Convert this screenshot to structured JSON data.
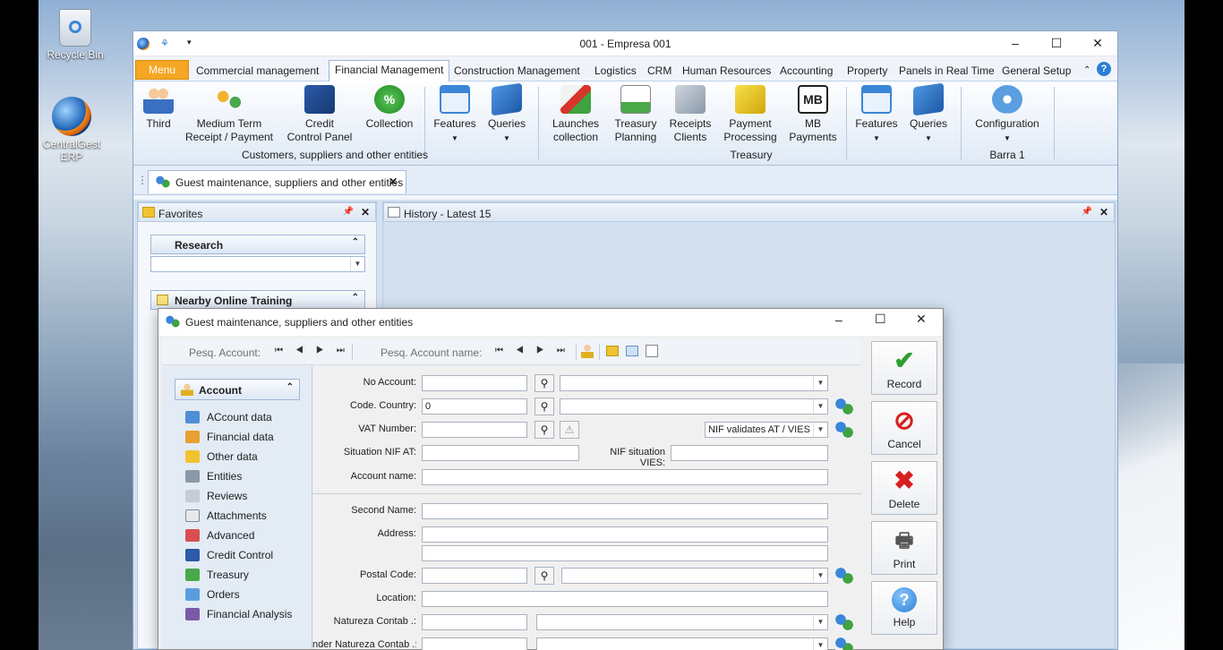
{
  "desktop": {
    "icons": [
      {
        "label": "Recycle Bin"
      },
      {
        "label": "CentralGest ERP"
      }
    ]
  },
  "window": {
    "title": "001 - Empresa 001",
    "controls": {
      "minimize": "–",
      "maximize": "☐",
      "close": "✕"
    }
  },
  "tabs": {
    "menu": "Menu",
    "items": [
      "Commercial management",
      "Financial Management",
      "Construction Management",
      "Logistics",
      "CRM",
      "Human Resources",
      "Accounting",
      "Property",
      "Panels in Real Time",
      "General Setup"
    ],
    "active": "Financial Management"
  },
  "ribbon": {
    "buttons": [
      {
        "label": "Third",
        "icon": "people-icon"
      },
      {
        "label": "Medium Term\nReceipt / Payment",
        "icon": "transfer-icon"
      },
      {
        "label": "Credit\nControl Panel",
        "icon": "card-icon"
      },
      {
        "label": "Collection",
        "icon": "percent-icon"
      },
      {
        "label": "Features",
        "icon": "window-icon"
      },
      {
        "label": "Queries",
        "icon": "book-icon"
      },
      {
        "label": "Launches\ncollection",
        "icon": "launch-icon"
      },
      {
        "label": "Treasury\nPlanning",
        "icon": "chart-icon"
      },
      {
        "label": "Receipts\nClients",
        "icon": "receipt-icon"
      },
      {
        "label": "Payment\nProcessing",
        "icon": "payment-icon"
      },
      {
        "label": "MB\nPayments",
        "icon": "mb-icon"
      },
      {
        "label": "Features",
        "icon": "window-icon"
      },
      {
        "label": "Queries",
        "icon": "book-icon"
      },
      {
        "label": "Configuration",
        "icon": "gear-icon"
      }
    ],
    "groups": [
      "Customers, suppliers and other entities",
      "Treasury",
      "Barra 1"
    ]
  },
  "doc_tab": {
    "label": "Guest maintenance, suppliers and other entities"
  },
  "favorites": {
    "title": "Favorites",
    "research": "Research",
    "training": "Nearby Online Training"
  },
  "history": {
    "title": "History - Latest 15"
  },
  "dialog": {
    "title": "Guest maintenance, suppliers and other entities",
    "toolbar": {
      "pesq_account": "Pesq. Account:",
      "pesq_account_name": "Pesq. Account name:"
    },
    "nav": {
      "header": "Account",
      "items": [
        "ACcount data",
        "Financial data",
        "Other data",
        "Entities",
        "Reviews",
        "Attachments",
        "Advanced",
        "Credit Control",
        "Treasury",
        "Orders",
        "Financial Analysis"
      ]
    },
    "form": {
      "no_account": "No Account:",
      "code_country": "Code. Country:",
      "code_country_value": "0",
      "vat_number": "VAT Number:",
      "nif_validates": "NIF validates AT / VIES",
      "situation_nif_at": "Situation NIF AT:",
      "nif_situation_vies": "NIF situation VIES:",
      "account_name": "Account name:",
      "second_name": "Second Name:",
      "address": "Address:",
      "postal_code": "Postal Code:",
      "location": "Location:",
      "natureza_contab": "Natureza Contab .:",
      "under_natureza": "nder Natureza Contab .:"
    },
    "actions": [
      {
        "label": "Record",
        "icon": "check-icon",
        "color": "#2e9e2e"
      },
      {
        "label": "Cancel",
        "icon": "cancel-icon",
        "color": "#d81e1e"
      },
      {
        "label": "Delete",
        "icon": "delete-icon",
        "color": "#d81e1e"
      },
      {
        "label": "Print",
        "icon": "printer-icon",
        "color": "#555555"
      },
      {
        "label": "Help",
        "icon": "help-icon",
        "color": "#2a7fd4"
      }
    ]
  }
}
